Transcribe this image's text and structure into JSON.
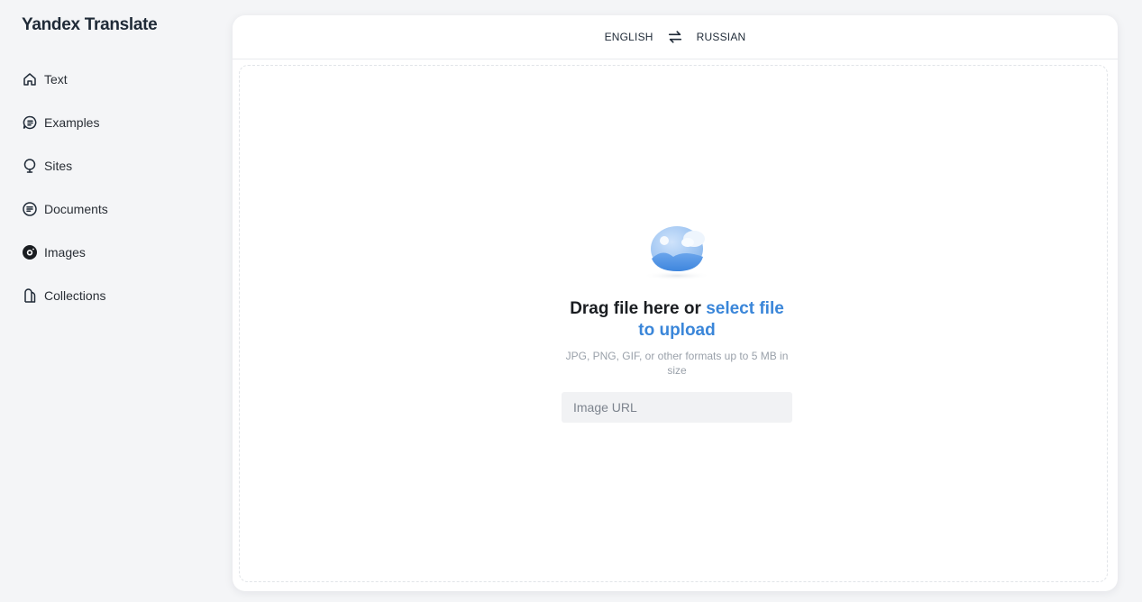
{
  "app": {
    "title": "Yandex Translate"
  },
  "sidebar": {
    "items": [
      {
        "label": "Text",
        "icon": "home-icon"
      },
      {
        "label": "Examples",
        "icon": "chat-bubble-icon"
      },
      {
        "label": "Sites",
        "icon": "globe-pin-icon"
      },
      {
        "label": "Documents",
        "icon": "document-icon"
      },
      {
        "label": "Images",
        "icon": "camera-icon",
        "active": true
      },
      {
        "label": "Collections",
        "icon": "bookmark-icon"
      }
    ]
  },
  "languages": {
    "source": "ENGLISH",
    "target": "RUSSIAN",
    "swap_icon": "swap-arrows-icon"
  },
  "upload": {
    "title_prefix": "Drag file here or ",
    "title_link": "select file to upload",
    "hint": "JPG, PNG, GIF, or other formats up to 5 MB in size",
    "url_placeholder": "Image URL",
    "illustration_icon": "image-upload-icon"
  },
  "colors": {
    "accent": "#3a86d9",
    "page_background": "#f4f5f7",
    "panel_background": "#ffffff",
    "input_background": "#f1f2f4"
  }
}
